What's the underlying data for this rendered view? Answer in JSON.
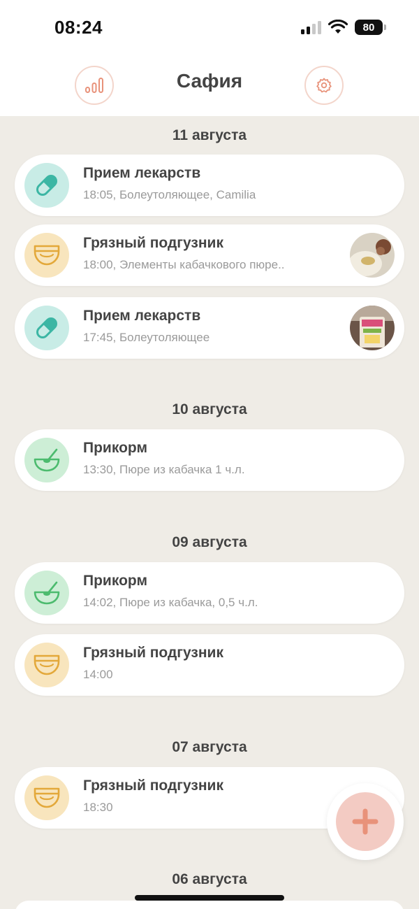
{
  "status": {
    "time": "08:24",
    "battery": "80"
  },
  "header": {
    "title": "Сафия",
    "stats_icon": "stats-bars-icon",
    "settings_icon": "gear-icon"
  },
  "groups": [
    {
      "date": "11 августа",
      "entries": [
        {
          "type": "med",
          "icon": "pill-icon",
          "title": "Прием лекарств",
          "subtitle": "18:05, Болеутоляющее, Camilia",
          "photo": false
        },
        {
          "type": "diaper",
          "icon": "diaper-icon",
          "title": "Грязный подгузник",
          "subtitle": "18:00, Элементы кабачкового пюре..",
          "photo": true
        },
        {
          "type": "med",
          "icon": "pill-icon",
          "title": "Прием лекарств",
          "subtitle": "17:45, Болеутоляющее",
          "photo": true
        }
      ]
    },
    {
      "date": "10 августа",
      "entries": [
        {
          "type": "food",
          "icon": "bowl-icon",
          "title": "Прикорм",
          "subtitle": "13:30, Пюре из кабачка 1 ч.л.",
          "photo": false
        }
      ]
    },
    {
      "date": "09 августа",
      "entries": [
        {
          "type": "food",
          "icon": "bowl-icon",
          "title": "Прикорм",
          "subtitle": "14:02, Пюре из кабачка, 0,5 ч.л.",
          "photo": false
        },
        {
          "type": "diaper",
          "icon": "diaper-icon",
          "title": "Грязный подгузник",
          "subtitle": "14:00",
          "photo": false
        }
      ]
    },
    {
      "date": "07 августа",
      "entries": [
        {
          "type": "diaper",
          "icon": "diaper-icon",
          "title": "Грязный подгузник",
          "subtitle": "18:30",
          "photo": false
        }
      ]
    },
    {
      "date": "06 августа",
      "entries": []
    }
  ],
  "fab": {
    "icon": "plus-icon"
  },
  "colors": {
    "background": "#efece6",
    "accent": "#e8927a",
    "med_bg": "#c8ece6",
    "med_fg": "#3cb6a4",
    "diaper_bg": "#f8e5bd",
    "diaper_fg": "#e3a83a",
    "food_bg": "#cdeed6",
    "food_fg": "#4cbb6e"
  }
}
